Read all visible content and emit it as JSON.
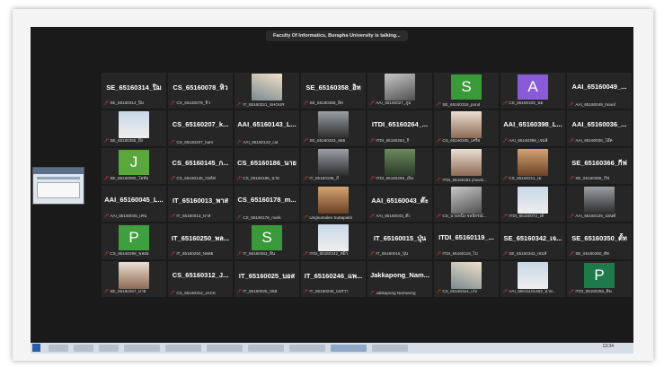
{
  "meeting": {
    "speaking_banner": "Faculty Of Informatics, Burapha University is talking..."
  },
  "colors": {
    "mic_off": "#e0463f",
    "avatar_S": "#3a9a3a",
    "avatar_A": "#8a5bd8",
    "avatar_J": "#5aa83c",
    "avatar_P": "#3f9f3f"
  },
  "participants": [
    {
      "big": "SE_65160314_ปิม",
      "cap": "SE_65160314_ปิม"
    },
    {
      "big": "CS_65160078_หิว",
      "cap": "CS_65160078_หิว"
    },
    {
      "photo": "p2",
      "cap": "IT_65160321_SHOUR"
    },
    {
      "big": "SE_65160358_อิท",
      "cap": "SE_65160358_อิท"
    },
    {
      "photo": "p1",
      "cap": "AAI_65160027_ภูม"
    },
    {
      "avatar": "S",
      "color": "#3a9a3a",
      "cap": "SE_65160316_pond"
    },
    {
      "avatar": "A",
      "color": "#8a5bd8",
      "cap": "CS_65160103_นอ"
    },
    {
      "big": "AAI_65160049_...",
      "cap": "AAI_65160049_tmaof"
    },
    {
      "photo": "p5",
      "cap": "SE_65160355_ผึง"
    },
    {
      "big": "CS_65160207_k...",
      "cap": "CS_65160207_karn"
    },
    {
      "big": "AAI_65160143_L...",
      "cap": "AAI_65160143_cat"
    },
    {
      "photo": "p6",
      "cap": "SE_65160323_ออย"
    },
    {
      "big": "ITDI_65160264_...",
      "cap": "ITDI_65160264_กิ"
    },
    {
      "photo": "p4",
      "cap": "CS_65160205_เครีย"
    },
    {
      "big": "AAI_65160398_L...",
      "cap": "AAI_65160398_เจมส์"
    },
    {
      "big": "AAI_65160036_...",
      "cap": "AAI_65160036_โอ๊ค"
    },
    {
      "avatar": "J",
      "color": "#5aa83c",
      "cap": "SE_65160060_โอห์ม"
    },
    {
      "big": "CS_65160145_ก...",
      "cap": "CS_65160145_กอล์ฟ"
    },
    {
      "big": "CS_65160186_นาย",
      "cap": "CS_65160186_นาย"
    },
    {
      "photo": "p6",
      "cap": "IT_65160196_ภี"
    },
    {
      "photo": "p3",
      "cap": "ITDI_65160258_เอ็น"
    },
    {
      "photo": "p4",
      "cap": "ITDI_65160281 jirawin..."
    },
    {
      "photo": "p7",
      "cap": "CS_65160211_เม"
    },
    {
      "big": "SE_65160366_กีฟ",
      "cap": "SE_65160366_กีฟ"
    },
    {
      "big": "AAI_65160045_L...",
      "cap": "AAI_65160045_เคน"
    },
    {
      "big": "IT_65160013_พาส",
      "cap": "IT_65160013_พาส"
    },
    {
      "big": "CS_65160178_m...",
      "cap": "CS_65160178_mark"
    },
    {
      "photo": "p7",
      "cap": "Ungsumalee Suttapakti"
    },
    {
      "big": "AAI_65160043_ต๊ะ",
      "cap": "AAI_65160043_ต๊ะ"
    },
    {
      "photo": "p1",
      "cap": "CS_นายหนึ่ง ชลธีธรณ์..."
    },
    {
      "photo": "p5",
      "cap": "ITDI_65160072_เต้"
    },
    {
      "photo": "p6",
      "cap": "AAI_65160139_ปอนด์"
    },
    {
      "avatar": "P",
      "color": "#3f9f3f",
      "cap": "CS_65160298_พลอย"
    },
    {
      "big": "IT_65160250_พล...",
      "cap": "IT_65160250_พลอย"
    },
    {
      "avatar": "S",
      "color": "#3a9a3a",
      "cap": "IT_65160363_สิน"
    },
    {
      "photo": "p5",
      "cap": "ITDI_65160242_หมิว"
    },
    {
      "big": "IT_65160015_ปุ่น",
      "cap": "IT_65160015_ปุ่น"
    },
    {
      "big": "ITDI_65160119_...",
      "cap": "ITDI_65160119_โบ"
    },
    {
      "big": "SE_65160342_เจ...",
      "cap": "SE_65160342_เจมส์"
    },
    {
      "big": "SE_65160350_ตั้ท",
      "cap": "SE_65160350_ตั้ท"
    },
    {
      "photo": "p4",
      "cap": "SE_65160267_มาย"
    },
    {
      "big": "CS_65160312_J...",
      "cap": "CS_65160312_JACK"
    },
    {
      "big": "IT_65160025_บอส",
      "cap": "IT_65160025_บอส"
    },
    {
      "big": "IT_65160246_แพ...",
      "cap": "IT_65160246_แพรวา"
    },
    {
      "big": "Jakkapong_Nam...",
      "cap": "Jakkapong Namwong"
    },
    {
      "photo": "p2",
      "cap": "CS_65160324_เก่ง"
    },
    {
      "photo": "p5",
      "cap": "AAI_65011101463_นาย..."
    },
    {
      "avatar": "P",
      "color": "#1e7a4a",
      "cap": "ITDI_65160256_ติน"
    }
  ],
  "taskbar": {
    "clock": "13:34"
  }
}
